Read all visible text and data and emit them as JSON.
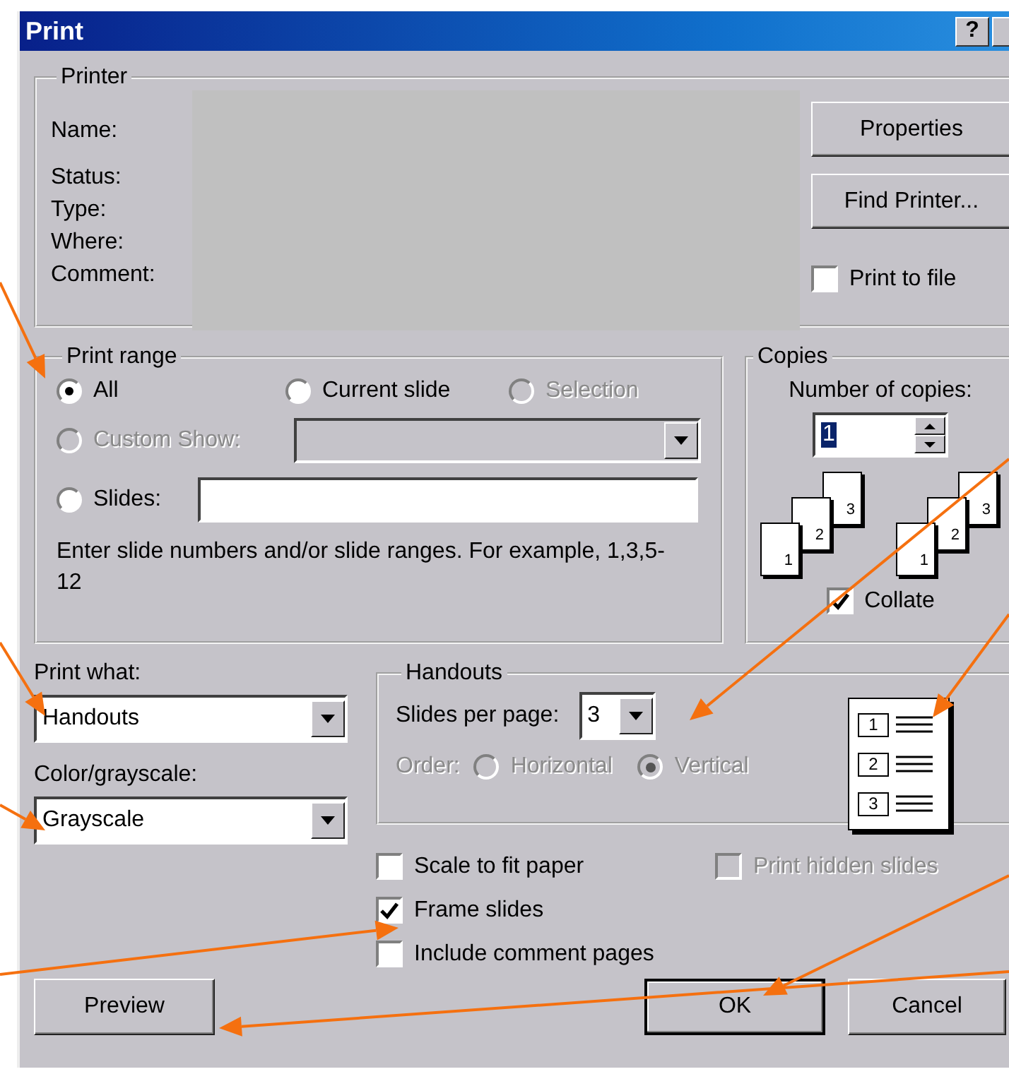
{
  "window": {
    "title": "Print",
    "help_button": "?"
  },
  "printer": {
    "title": "Printer",
    "labels": [
      "Name:",
      "Status:",
      "Type:",
      "Where:",
      "Comment:"
    ],
    "buttons": [
      "Properties",
      "Find Printer..."
    ],
    "print_to_file": {
      "label": "Print to file",
      "checked": false
    }
  },
  "print_range": {
    "title": "Print range",
    "options": [
      {
        "label": "All",
        "selected": true,
        "disabled": false
      },
      {
        "label": "Current slide",
        "selected": false,
        "disabled": false
      },
      {
        "label": "Selection",
        "selected": false,
        "disabled": true
      },
      {
        "label": "Custom Show:",
        "selected": false,
        "disabled": true
      },
      {
        "label": "Slides:",
        "selected": false,
        "disabled": false
      }
    ],
    "hint": "Enter slide numbers and/or slide ranges. For example, 1,3,5-12"
  },
  "copies": {
    "title": "Copies",
    "label": "Number of copies:",
    "value": "1",
    "stacks": [
      [
        "1",
        "2",
        "3"
      ],
      [
        "1",
        "2",
        "3"
      ]
    ],
    "collate": {
      "label": "Collate",
      "checked": true
    }
  },
  "print_what": {
    "label": "Print what:",
    "value": "Handouts"
  },
  "color_grayscale": {
    "label": "Color/grayscale:",
    "value": "Grayscale"
  },
  "handouts": {
    "title": "Handouts",
    "slides_label": "Slides per page:",
    "slides_value": "3",
    "order_label": "Order:",
    "order_disabled": true,
    "order_options": [
      {
        "label": "Horizontal",
        "selected": false
      },
      {
        "label": "Vertical",
        "selected": true
      }
    ],
    "preview": [
      "1",
      "2",
      "3"
    ]
  },
  "options": [
    {
      "label": "Scale to fit paper",
      "checked": false,
      "disabled": false
    },
    {
      "label": "Print hidden slides",
      "checked": false,
      "disabled": true
    },
    {
      "label": "Frame slides",
      "checked": true,
      "disabled": false
    },
    {
      "label": "Include comment pages",
      "checked": false,
      "disabled": false
    }
  ],
  "buttons": [
    {
      "label": "Preview",
      "default": false
    },
    {
      "label": "OK",
      "default": true
    },
    {
      "label": "Cancel",
      "default": false
    }
  ]
}
